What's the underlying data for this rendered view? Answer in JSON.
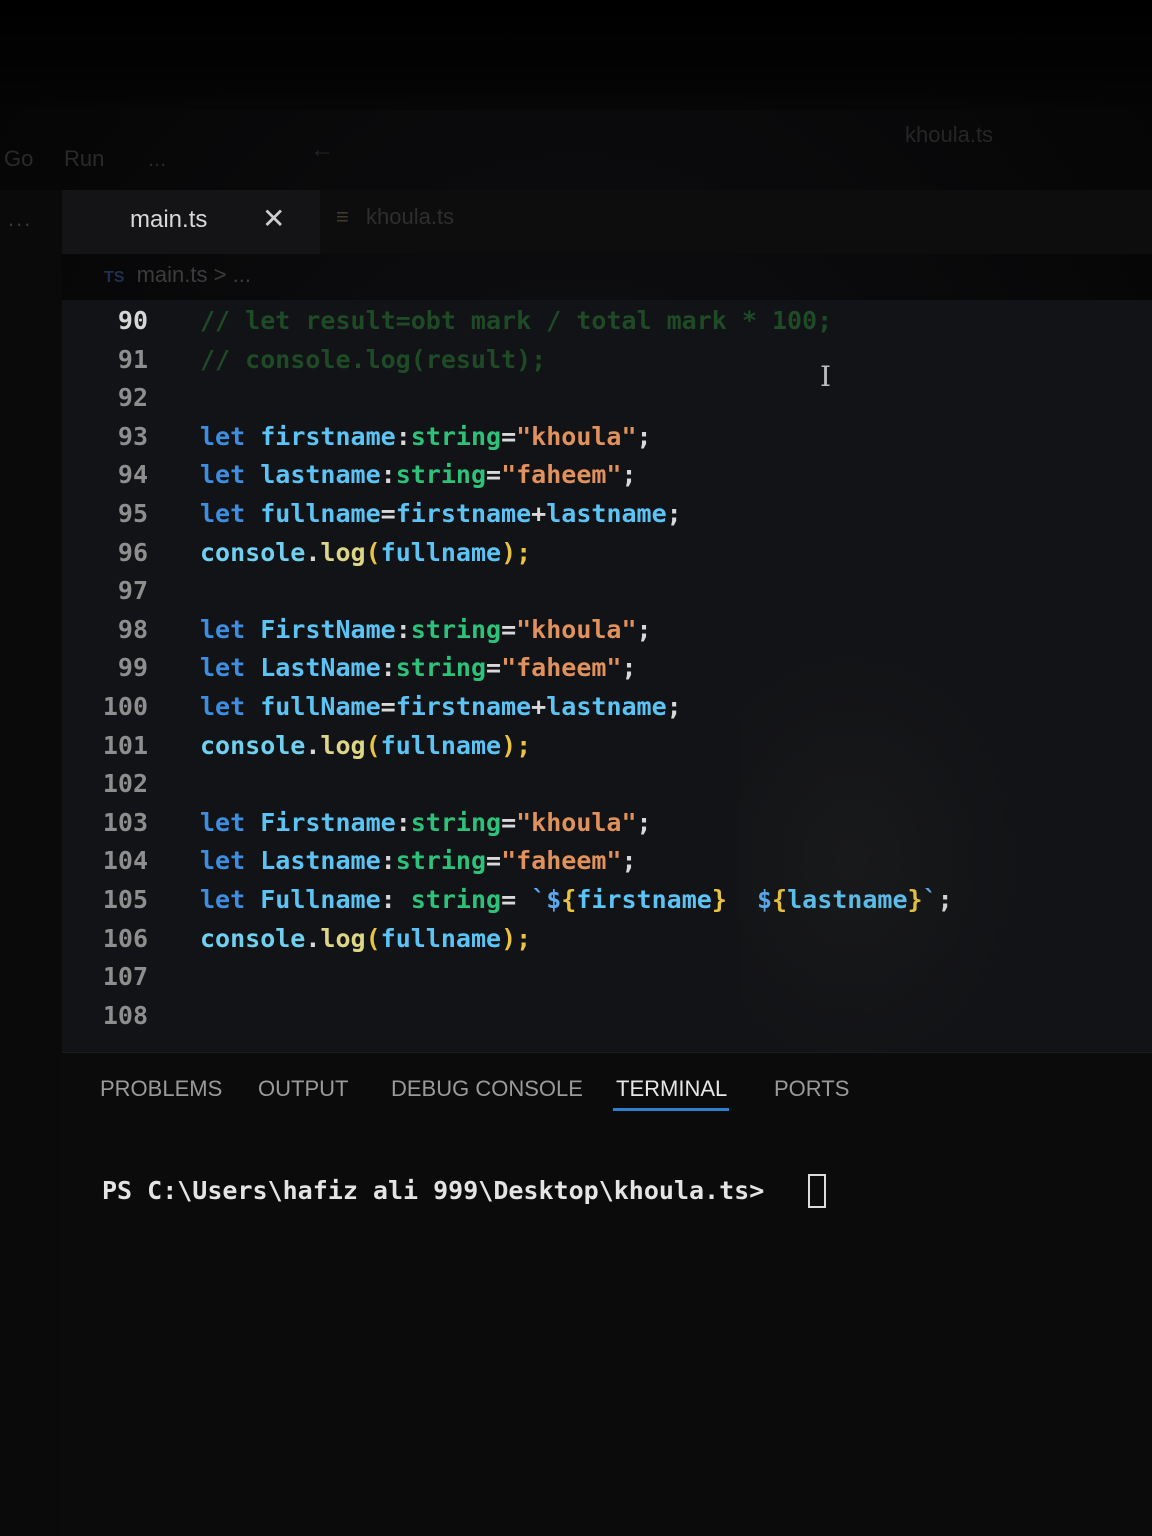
{
  "menu": {
    "items": [
      "Go",
      "Run",
      "..."
    ],
    "window_title": "khoula.ts"
  },
  "activity_bar": {
    "more": "..."
  },
  "tabs": [
    {
      "label": "main.ts",
      "active": true
    },
    {
      "label": "khoula.ts",
      "active": false
    }
  ],
  "breadcrumb": {
    "icon": "TS",
    "file": "main.ts",
    "separator": ">",
    "rest": "..."
  },
  "editor": {
    "lines": [
      {
        "num": "90",
        "text": "// let result=obt mark / total mark * 100;"
      },
      {
        "num": "91",
        "text": "// console.log(result);"
      },
      {
        "num": "92",
        "text": ""
      },
      {
        "num": "93",
        "text": "let firstname:string=\"khoula\";"
      },
      {
        "num": "94",
        "text": "let lastname:string=\"faheem\";"
      },
      {
        "num": "95",
        "text": "let fullname=firstname+lastname;"
      },
      {
        "num": "96",
        "text": "console.log(fullname);"
      },
      {
        "num": "97",
        "text": ""
      },
      {
        "num": "98",
        "text": "let FirstName:string=\"khoula\";"
      },
      {
        "num": "99",
        "text": "let LastName:string=\"faheem\";"
      },
      {
        "num": "100",
        "text": "let fullName=firstname+lastname;"
      },
      {
        "num": "101",
        "text": "console.log(fullname);"
      },
      {
        "num": "102",
        "text": ""
      },
      {
        "num": "103",
        "text": "let Firstname:string=\"khoula\";"
      },
      {
        "num": "104",
        "text": "let Lastname:string=\"faheem\";"
      },
      {
        "num": "105",
        "text": "let Fullname: string= `${firstname}  ${lastname}`;"
      },
      {
        "num": "106",
        "text": "console.log(fullname);"
      },
      {
        "num": "107",
        "text": ""
      },
      {
        "num": "108",
        "text": ""
      }
    ]
  },
  "panel": {
    "tabs": [
      "PROBLEMS",
      "OUTPUT",
      "DEBUG CONSOLE",
      "TERMINAL",
      "PORTS"
    ],
    "active_tab": "TERMINAL",
    "terminal_prompt": "PS C:\\Users\\hafiz ali 999\\Desktop\\khoula.ts>"
  },
  "colors": {
    "keyword": "#3d8ee0",
    "variable": "#5cc4f5",
    "type": "#2dc27a",
    "string": "#e0915c",
    "function": "#dcd685",
    "accent": "#2f7fd1"
  },
  "icons": [
    "close-icon",
    "file-icon",
    "back-arrow-icon",
    "text-cursor-icon",
    "terminal-cursor"
  ]
}
